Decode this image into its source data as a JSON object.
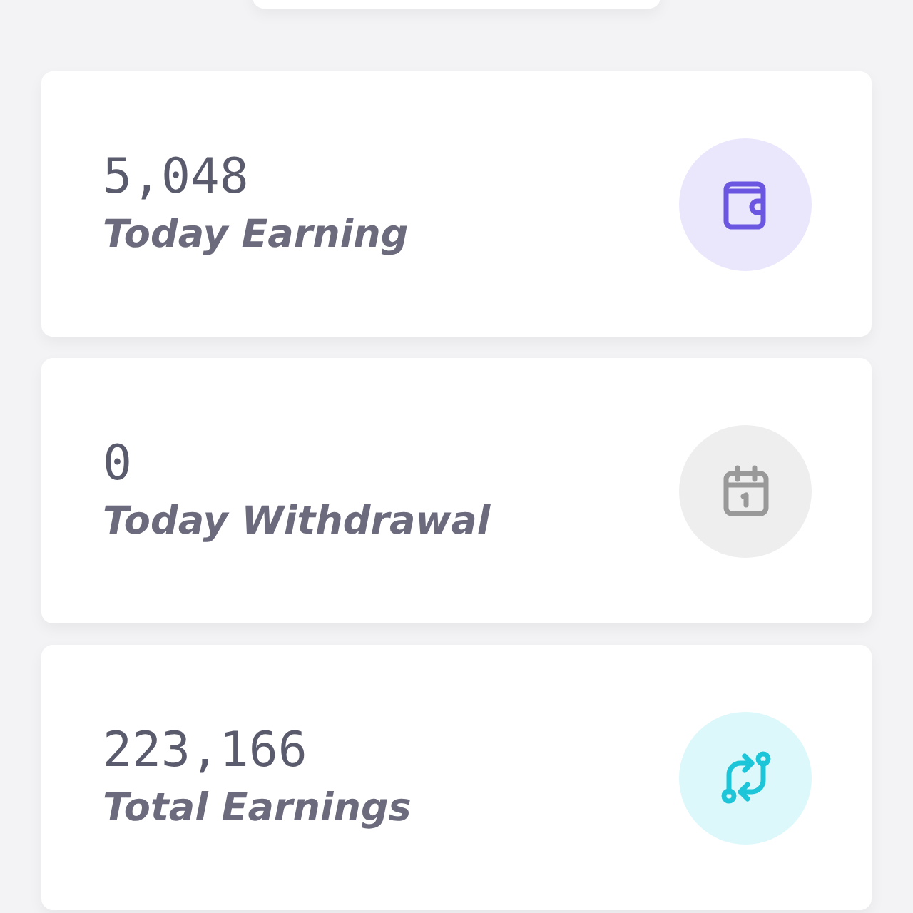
{
  "stats": [
    {
      "value": "5,048",
      "label": "Today Earning",
      "kind": "wallet"
    },
    {
      "value": "0",
      "label": "Today Withdrawal",
      "kind": "calendar"
    },
    {
      "value": "223,166",
      "label": "Total Earnings",
      "kind": "exchange"
    }
  ]
}
